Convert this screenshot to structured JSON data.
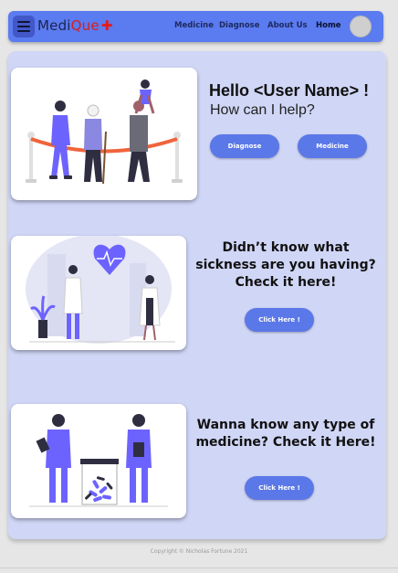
{
  "navbar": {
    "brand_part1": "Medi",
    "brand_part2": "Que",
    "links": [
      {
        "label": "Medicine"
      },
      {
        "label": "Diagnose"
      },
      {
        "label": "About Us"
      },
      {
        "label": "Home"
      }
    ]
  },
  "hero": {
    "greeting": "Hello <User Name> !",
    "subtitle": "How can I help?",
    "diagnose_button": "Diagnose",
    "medicine_button": "Medicine"
  },
  "diagnose_section": {
    "heading": "Didn’t know what sickness are you having? Check it here!",
    "button": "Click Here !"
  },
  "medicine_section": {
    "heading": "Wanna know any type of medicine? Check it Here!",
    "button": "Click Here !"
  },
  "footer": {
    "copyright": "Copyright © Nicholas Fortune 2021"
  },
  "colors": {
    "navbar": "#5b7bf0",
    "panel": "#d0d6f6",
    "button": "#5b78e8",
    "accent_red": "#d81e1e",
    "illustration_purple": "#6c63ff"
  },
  "icons": [
    "hamburger-menu-icon",
    "red-cross-icon",
    "user-avatar",
    "heart-pulse-icon"
  ]
}
